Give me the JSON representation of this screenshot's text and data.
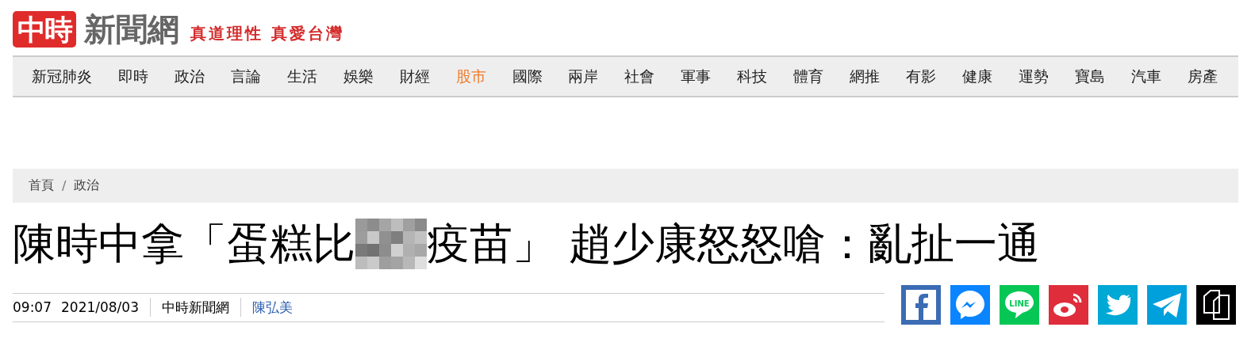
{
  "header": {
    "logo_badge": "中時",
    "logo_text": "新聞網",
    "slogan": "真道理性 真愛台灣"
  },
  "nav": [
    {
      "label": "新冠肺炎",
      "selected": false
    },
    {
      "label": "即時",
      "selected": false
    },
    {
      "label": "政治",
      "selected": false
    },
    {
      "label": "言論",
      "selected": false
    },
    {
      "label": "生活",
      "selected": false
    },
    {
      "label": "娛樂",
      "selected": false
    },
    {
      "label": "財經",
      "selected": false
    },
    {
      "label": "股市",
      "selected": true
    },
    {
      "label": "國際",
      "selected": false
    },
    {
      "label": "兩岸",
      "selected": false
    },
    {
      "label": "社會",
      "selected": false
    },
    {
      "label": "軍事",
      "selected": false
    },
    {
      "label": "科技",
      "selected": false
    },
    {
      "label": "體育",
      "selected": false
    },
    {
      "label": "網推",
      "selected": false
    },
    {
      "label": "有影",
      "selected": false
    },
    {
      "label": "健康",
      "selected": false
    },
    {
      "label": "運勢",
      "selected": false
    },
    {
      "label": "寶島",
      "selected": false
    },
    {
      "label": "汽車",
      "selected": false
    },
    {
      "label": "房產",
      "selected": false
    }
  ],
  "breadcrumb": [
    "首頁",
    "政治"
  ],
  "breadcrumb_separator": "/",
  "title": {
    "before": "陳時中拿「蛋糕比",
    "after": "疫苗」 趙少康怒怒嗆：亂扯一通"
  },
  "meta": {
    "time": "09:07",
    "date": "2021/08/03",
    "source": "中時新聞網",
    "author": "陳弘美"
  },
  "share": [
    {
      "kind": "facebook"
    },
    {
      "kind": "messenger"
    },
    {
      "kind": "line",
      "label": "LINE"
    },
    {
      "kind": "weibo"
    },
    {
      "kind": "twitter"
    },
    {
      "kind": "telegram"
    },
    {
      "kind": "copy"
    }
  ]
}
